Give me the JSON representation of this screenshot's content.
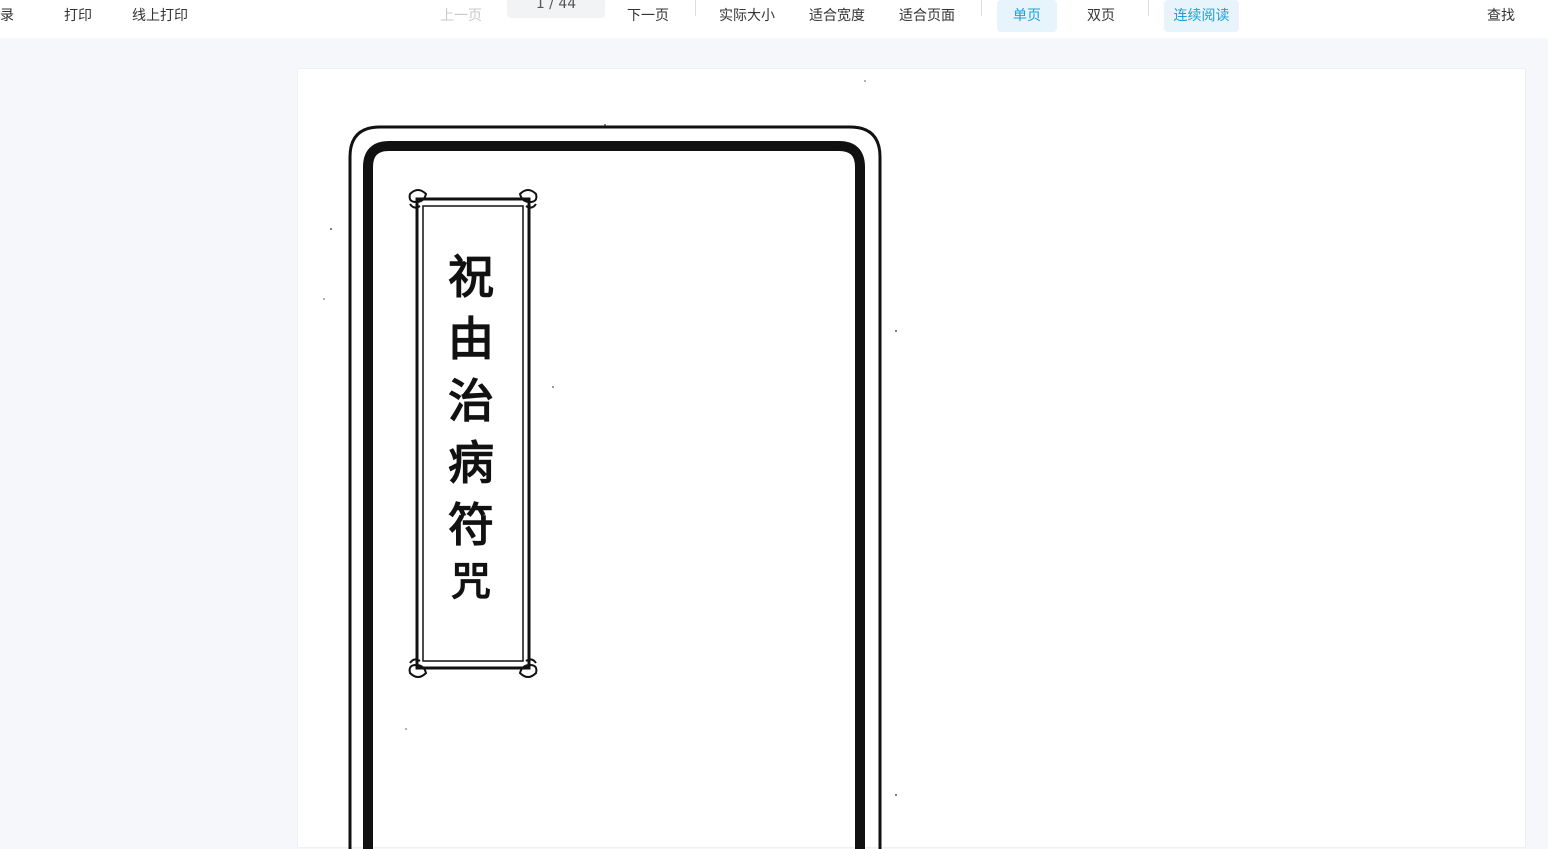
{
  "toolbar": {
    "toc_label": "目录",
    "print_label": "打印",
    "online_print_label": "线上打印",
    "prev_page_label": "上一页",
    "page_indicator": "1 / 44",
    "next_page_label": "下一页",
    "actual_size_label": "实际大小",
    "fit_width_label": "适合宽度",
    "fit_page_label": "适合页面",
    "single_page_label": "单页",
    "double_page_label": "双页",
    "continuous_label": "连续阅读",
    "find_label": "查找"
  },
  "document": {
    "title_chars": [
      "祝",
      "由",
      "治",
      "病",
      "符",
      "咒"
    ]
  },
  "colors": {
    "accent": "#1aa0d8",
    "active_bg": "#e8f4fb",
    "viewer_bg": "#f5f7fa"
  }
}
